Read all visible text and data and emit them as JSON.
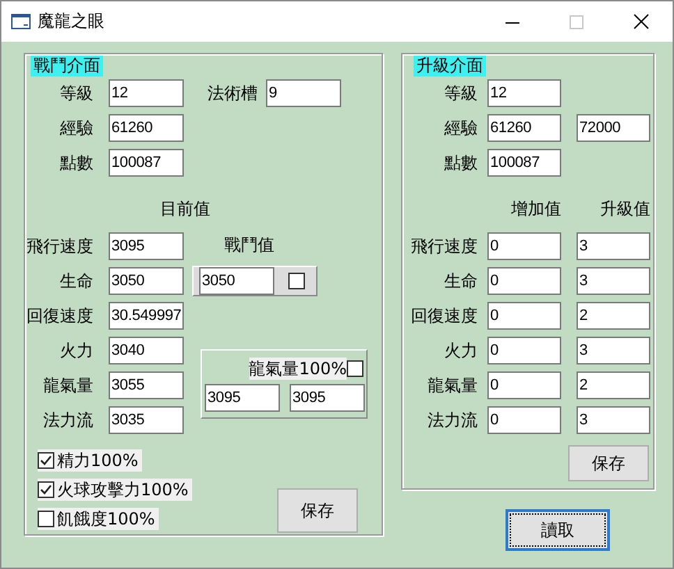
{
  "window": {
    "title": "魔龍之眼"
  },
  "combat_panel": {
    "title": "戰鬥介面",
    "level": {
      "label": "等級",
      "value": "12"
    },
    "spell_slot": {
      "label": "法術槽",
      "value": "9"
    },
    "exp": {
      "label": "經驗",
      "value": "61260"
    },
    "points": {
      "label": "點數",
      "value": "100087"
    },
    "current_header": "目前值",
    "stats": [
      {
        "label": "飛行速度",
        "value": "3095"
      },
      {
        "label": "生命",
        "value": "3050"
      },
      {
        "label": "回復速度",
        "value": "30.549997"
      },
      {
        "label": "火力",
        "value": "3040"
      },
      {
        "label": "龍氣量",
        "value": "3055"
      },
      {
        "label": "法力流",
        "value": "3035"
      }
    ],
    "battle_value": {
      "label": "戰鬥值",
      "value": "3050",
      "checked": false
    },
    "dragon_box": {
      "label": "龍氣量100%",
      "checked": false,
      "values": [
        "3095",
        "3095"
      ]
    },
    "options": [
      {
        "label": "精力100%",
        "checked": true
      },
      {
        "label": "火球攻擊力100%",
        "checked": true
      },
      {
        "label": "飢餓度100%",
        "checked": false
      }
    ],
    "save_button": "保存"
  },
  "upgrade_panel": {
    "title": "升級介面",
    "level": {
      "label": "等級",
      "value": "12"
    },
    "exp": {
      "label": "經驗",
      "value": "61260",
      "value_2": "72000"
    },
    "points": {
      "label": "點數",
      "value": "100087"
    },
    "headers": [
      "增加值",
      "升級值"
    ],
    "stats": [
      {
        "label": "飛行速度",
        "increase": "0",
        "upgrade": "3"
      },
      {
        "label": "生命",
        "increase": "0",
        "upgrade": "3"
      },
      {
        "label": "回復速度",
        "increase": "0",
        "upgrade": "2"
      },
      {
        "label": "火力",
        "increase": "0",
        "upgrade": "3"
      },
      {
        "label": "龍氣量",
        "increase": "0",
        "upgrade": "2"
      },
      {
        "label": "法力流",
        "increase": "0",
        "upgrade": "3"
      }
    ],
    "save_button": "保存"
  },
  "read_button": "讀取"
}
